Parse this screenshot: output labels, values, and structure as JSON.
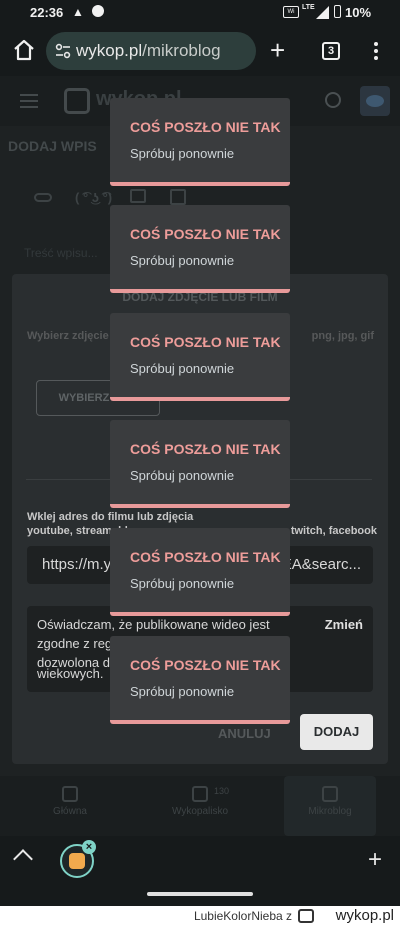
{
  "status_bar": {
    "time": "22:36",
    "network": "LTE",
    "battery": "10%"
  },
  "browser": {
    "url_domain": "wykop.pl",
    "url_path": "/mikroblog",
    "tab_count": "3"
  },
  "site": {
    "logo_text": "wykop.pl",
    "page_title": "DODAJ WPIS",
    "lenny": "( ͡° ͜ʖ ͡°)",
    "post_placeholder": "Treść wpisu..."
  },
  "modal": {
    "title": "DODAJ ZDJĘCIE LUB FILM",
    "choose_hint": "Wybierz zdjęcie",
    "formats": "png, jpg, gif",
    "choose_button": "WYBIERZ PLIK",
    "url_label": "Wklej adres do filmu lub zdjęcia",
    "url_sources_left": "youtube, streamable",
    "url_sources_right": "twitch, facebook",
    "url_value_left": "https://m.y",
    "url_value_right": "EA&searc...",
    "declaration_first": "Oświadczam, że publikowane wideo jest",
    "declaration_l2": "zgodne z reg",
    "declaration_l3": "dozwolona d",
    "declaration_l4": "wiekowych.",
    "change_label": "Zmień",
    "cancel_label": "ANULUJ",
    "add_label": "DODAJ"
  },
  "bottom_nav": {
    "items": [
      {
        "label": "Główna"
      },
      {
        "label": "Wykopalisko"
      },
      {
        "label": "Mikroblog"
      }
    ],
    "count": "130"
  },
  "toasts": [
    {
      "title": "COŚ POSZŁO NIE TAK",
      "message": "Spróbuj ponownie"
    },
    {
      "title": "COŚ POSZŁO NIE TAK",
      "message": "Spróbuj ponownie"
    },
    {
      "title": "COŚ POSZŁO NIE TAK",
      "message": "Spróbuj ponownie"
    },
    {
      "title": "COŚ POSZŁO NIE TAK",
      "message": "Spróbuj ponownie"
    },
    {
      "title": "COŚ POSZŁO NIE TAK",
      "message": "Spróbuj ponownie"
    },
    {
      "title": "COŚ POSZŁO NIE TAK",
      "message": "Spróbuj ponownie"
    }
  ],
  "watermark": {
    "user": "LubieKolorNieba z",
    "site": "wykop.pl"
  },
  "colors": {
    "toast_accent": "#e89a9a",
    "toast_title": "#ee9d9a",
    "chrome_accent": "#7fd3c7"
  }
}
